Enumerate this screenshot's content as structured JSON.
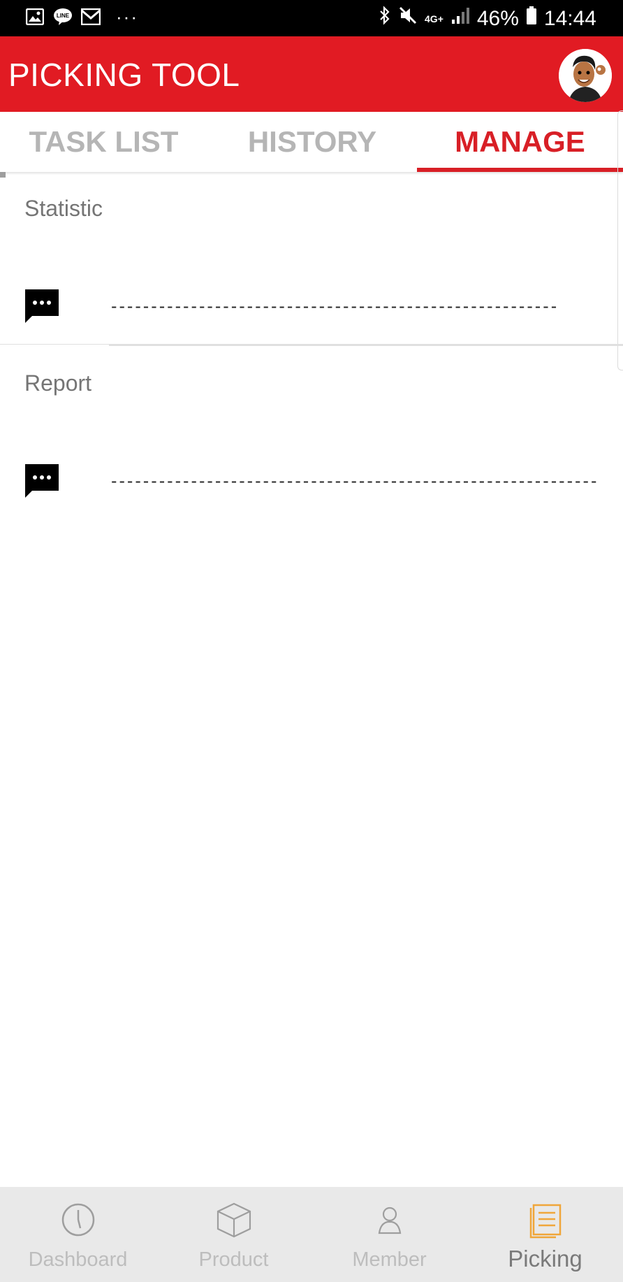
{
  "status_bar": {
    "left_icons": [
      "gallery-icon",
      "line-icon",
      "mail-icon"
    ],
    "more": "···",
    "network": "4G+",
    "battery": "46%",
    "time": "14:44"
  },
  "header": {
    "title": "PICKING TOOL",
    "brand_color": "#e11b23"
  },
  "tabs": [
    {
      "label": "TASK LIST",
      "active": false
    },
    {
      "label": "HISTORY",
      "active": false
    },
    {
      "label": "MANAGE",
      "active": true
    }
  ],
  "sections": [
    {
      "title": "Statistic",
      "item_text": "-----------------------------------------------------------------------"
    },
    {
      "title": "Report",
      "item_text": "---------------------------------------------------------------------------...",
      "icon": "message-icon"
    }
  ],
  "bottom_nav": [
    {
      "label": "Dashboard",
      "icon": "clock-icon",
      "active": false
    },
    {
      "label": "Product",
      "icon": "box-icon",
      "active": false
    },
    {
      "label": "Member",
      "icon": "person-icon",
      "active": false
    },
    {
      "label": "Picking",
      "icon": "picking-list-icon",
      "active": true,
      "color": "#f0a63a"
    }
  ]
}
